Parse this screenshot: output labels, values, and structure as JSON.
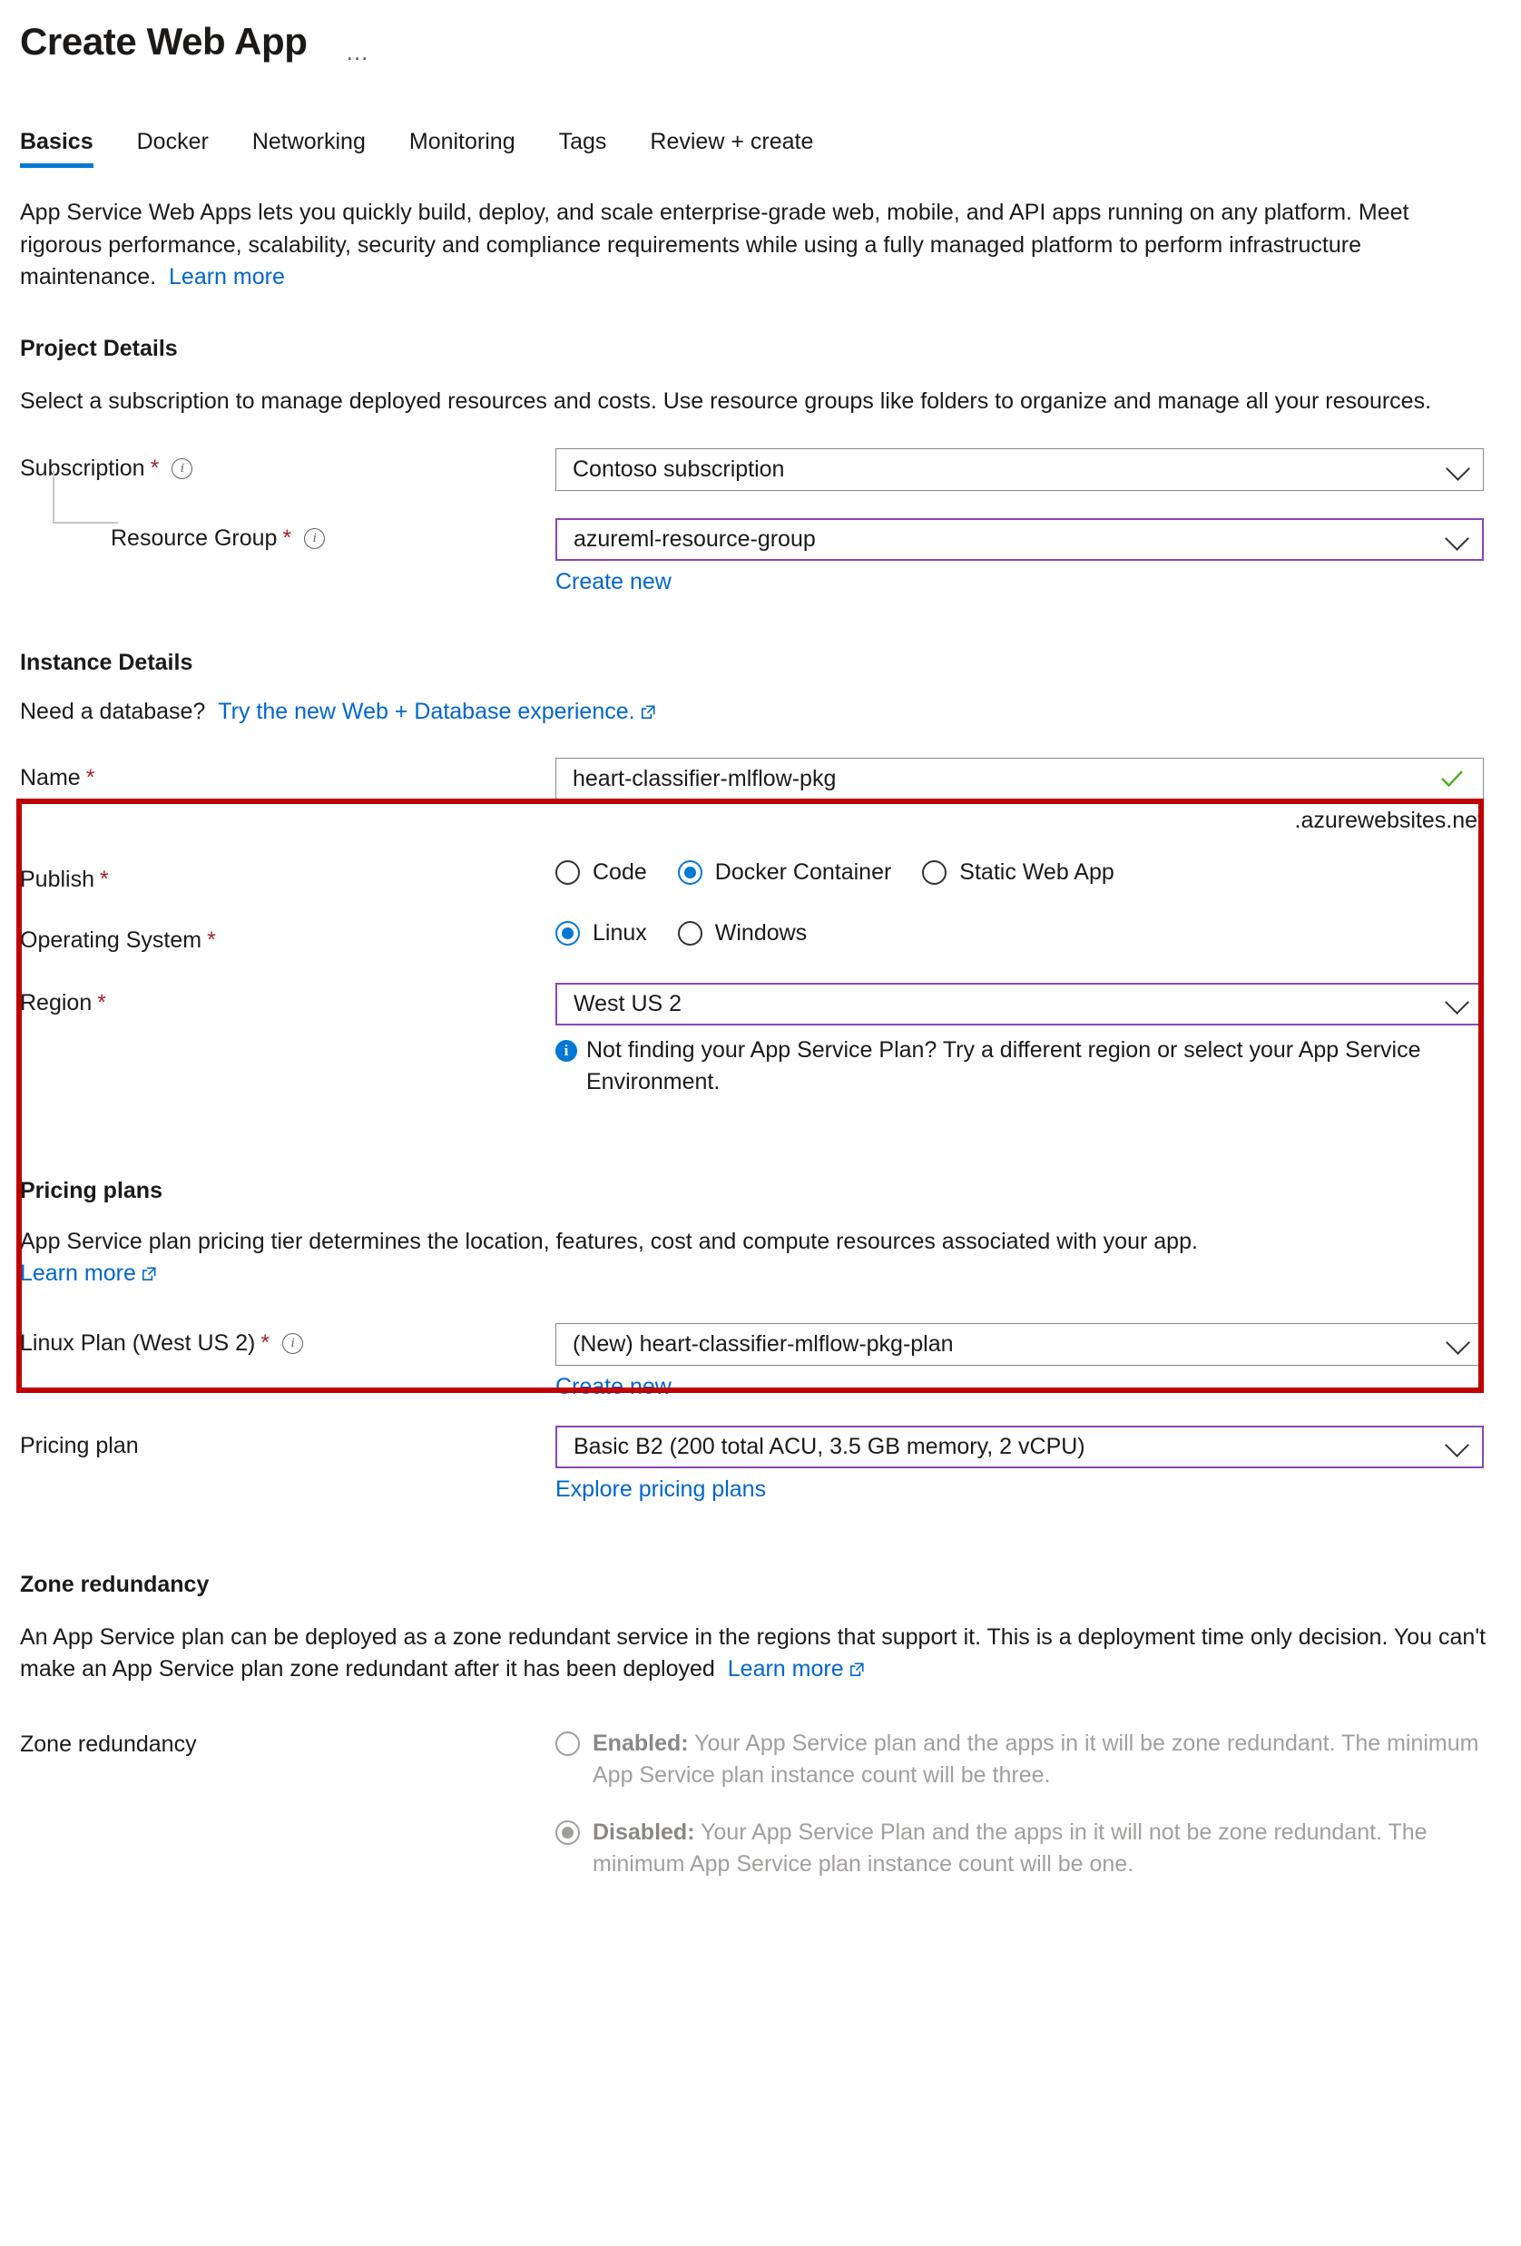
{
  "header": {
    "title": "Create Web App",
    "more_label": "…"
  },
  "tabs": [
    {
      "label": "Basics",
      "active": true
    },
    {
      "label": "Docker",
      "active": false
    },
    {
      "label": "Networking",
      "active": false
    },
    {
      "label": "Monitoring",
      "active": false
    },
    {
      "label": "Tags",
      "active": false
    },
    {
      "label": "Review + create",
      "active": false
    }
  ],
  "intro": {
    "text": "App Service Web Apps lets you quickly build, deploy, and scale enterprise-grade web, mobile, and API apps running on any platform. Meet rigorous performance, scalability, security and compliance requirements while using a fully managed platform to perform infrastructure maintenance.",
    "learn_more": "Learn more"
  },
  "project_details": {
    "heading": "Project Details",
    "description": "Select a subscription to manage deployed resources and costs. Use resource groups like folders to organize and manage all your resources.",
    "subscription": {
      "label": "Subscription",
      "required": "*",
      "value": "Contoso subscription"
    },
    "resource_group": {
      "label": "Resource Group",
      "required": "*",
      "value": "azureml-resource-group",
      "create_new": "Create new"
    }
  },
  "instance_details": {
    "heading": "Instance Details",
    "database_prompt": "Need a database?",
    "database_link": "Try the new Web + Database experience.",
    "name": {
      "label": "Name",
      "required": "*",
      "value": "heart-classifier-mlflow-pkg",
      "suffix": ".azurewebsites.net"
    },
    "publish": {
      "label": "Publish",
      "required": "*",
      "options": [
        {
          "label": "Code",
          "selected": false
        },
        {
          "label": "Docker Container",
          "selected": true
        },
        {
          "label": "Static Web App",
          "selected": false
        }
      ]
    },
    "operating_system": {
      "label": "Operating System",
      "required": "*",
      "options": [
        {
          "label": "Linux",
          "selected": true
        },
        {
          "label": "Windows",
          "selected": false
        }
      ]
    },
    "region": {
      "label": "Region",
      "required": "*",
      "value": "West US 2",
      "info_message": "Not finding your App Service Plan? Try a different region or select your App Service Environment."
    }
  },
  "pricing_plans": {
    "heading": "Pricing plans",
    "description": "App Service plan pricing tier determines the location, features, cost and compute resources associated with your app.",
    "learn_more": "Learn more",
    "linux_plan": {
      "label": "Linux Plan (West US 2)",
      "required": "*",
      "value": "(New) heart-classifier-mlflow-pkg-plan",
      "create_new": "Create new"
    },
    "pricing_plan": {
      "label": "Pricing plan",
      "value": "Basic B2 (200 total ACU, 3.5 GB memory, 2 vCPU)",
      "explore_link": "Explore pricing plans"
    }
  },
  "zone_redundancy": {
    "heading": "Zone redundancy",
    "description": "An App Service plan can be deployed as a zone redundant service in the regions that support it. This is a deployment time only decision. You can't make an App Service plan zone redundant after it has been deployed",
    "learn_more": "Learn more",
    "field_label": "Zone redundancy",
    "options": [
      {
        "bold": "Enabled:",
        "text": " Your App Service plan and the apps in it will be zone redundant. The minimum App Service plan instance count will be three.",
        "selected": false
      },
      {
        "bold": "Disabled:",
        "text": " Your App Service Plan and the apps in it will not be zone redundant. The minimum App Service plan instance count will be one.",
        "selected": true
      }
    ]
  },
  "colors": {
    "accent_blue": "#0078d4",
    "link_blue": "#0066cc",
    "required_red": "#a4262c",
    "highlight_red": "#c00000",
    "field_accent_purple": "#8c44b8",
    "success_green": "#4caf22"
  }
}
